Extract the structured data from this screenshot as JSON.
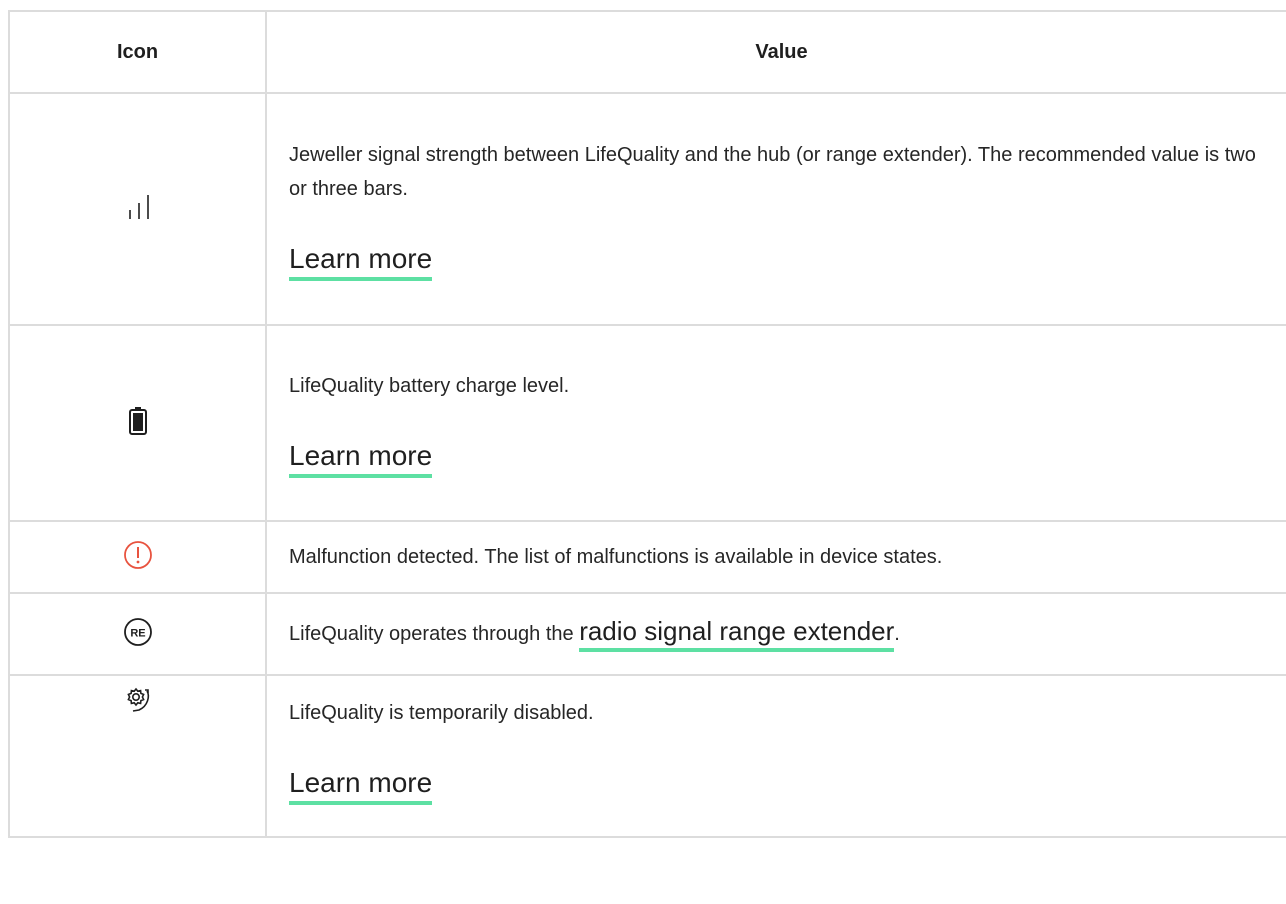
{
  "table": {
    "headers": {
      "icon": "Icon",
      "value": "Value"
    },
    "rows": [
      {
        "icon": "signal-strength-icon",
        "description": "Jeweller signal strength between LifeQuality and the hub (or range extender). The recommended value is two or three bars.",
        "link": "Learn more"
      },
      {
        "icon": "battery-icon",
        "description": "LifeQuality battery charge level.",
        "link": "Learn more"
      },
      {
        "icon": "malfunction-icon",
        "description": "Malfunction detected. The list of malfunctions is available in device states."
      },
      {
        "icon": "range-extender-icon",
        "icon_text": "RE",
        "description_prefix": "LifeQuality operates through the ",
        "link": "radio signal range extender",
        "description_suffix": "."
      },
      {
        "icon": "temporarily-disabled-icon",
        "description": "LifeQuality is temporarily disabled.",
        "link": "Learn more"
      }
    ]
  },
  "colors": {
    "link_underline": "#5de0a3",
    "malfunction": "#e8533f",
    "border": "#dcdcdc"
  }
}
